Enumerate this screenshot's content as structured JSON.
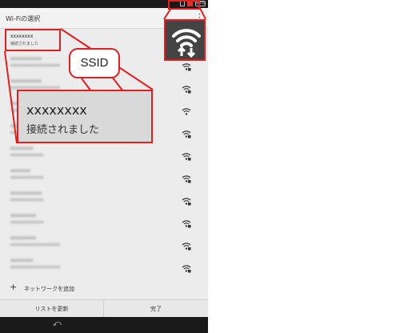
{
  "title_bar": {
    "title": "Wi-Fiの選択",
    "menu_icon": "overflow-menu-icon"
  },
  "status_bar": {
    "battery_text": "90%"
  },
  "networks": [
    {
      "ssid": "xxxxxxxx",
      "status": "接続されました",
      "icon": "wifi-locked-icon",
      "blurred": false
    },
    {
      "ssid": "xxxxxxxxxxx",
      "status": "xxxxxxxxxxxxxxxxxxxxx",
      "icon": "wifi-locked-icon",
      "blurred": true
    },
    {
      "ssid": "xxxxxxxxxxx",
      "status": "xxxxxxxxxxxxxxxxxxxxx",
      "icon": "wifi-locked-icon",
      "blurred": true
    },
    {
      "ssid": "xxxxxxxxxxx",
      "status": "xxxxxxxxxxxxxxxxxxxxx",
      "icon": "wifi-icon",
      "blurred": true
    },
    {
      "ssid": "xxxxxxxxxxx",
      "status": "xxxxxxxxxxxxxxxxxxxxx",
      "icon": "wifi-locked-icon",
      "blurred": true
    },
    {
      "ssid": "xxxxxxxx",
      "status": "xxxxxxxxxxxxxx",
      "icon": "wifi-locked-icon",
      "blurred": true
    },
    {
      "ssid": "xxxxxxx",
      "status": "xxxxxxxxxxxxxx",
      "icon": "wifi-locked-icon",
      "blurred": true
    },
    {
      "ssid": "xxxxxxxxxxx",
      "status": "xxxxxxxxxxxxxx",
      "icon": "wifi-locked-icon",
      "blurred": true
    },
    {
      "ssid": "xxxxxxxxx",
      "status": "xxxxxxxxxxxxxx",
      "icon": "wifi-locked-icon",
      "blurred": true
    },
    {
      "ssid": "xxxxxxxxx",
      "status": "xxxxxxxxxxxxxxxxxxxxx",
      "icon": "wifi-locked-icon",
      "blurred": true
    },
    {
      "ssid": "xxxxxxxx",
      "status": "xxxxxxxxxxxxxxxxxxxxx",
      "icon": "wifi-locked-icon",
      "blurred": true
    }
  ],
  "add_network_label": "ネットワークを追加",
  "buttons": {
    "refresh_label": "リストを更新",
    "done_label": "完了"
  },
  "callout": {
    "label": "SSID",
    "zoom_ssid": "xxxxxxxx",
    "zoom_status": "接続されました"
  },
  "colors": {
    "highlight": "#e02020",
    "wifi_zoom_bg": "#444444"
  }
}
